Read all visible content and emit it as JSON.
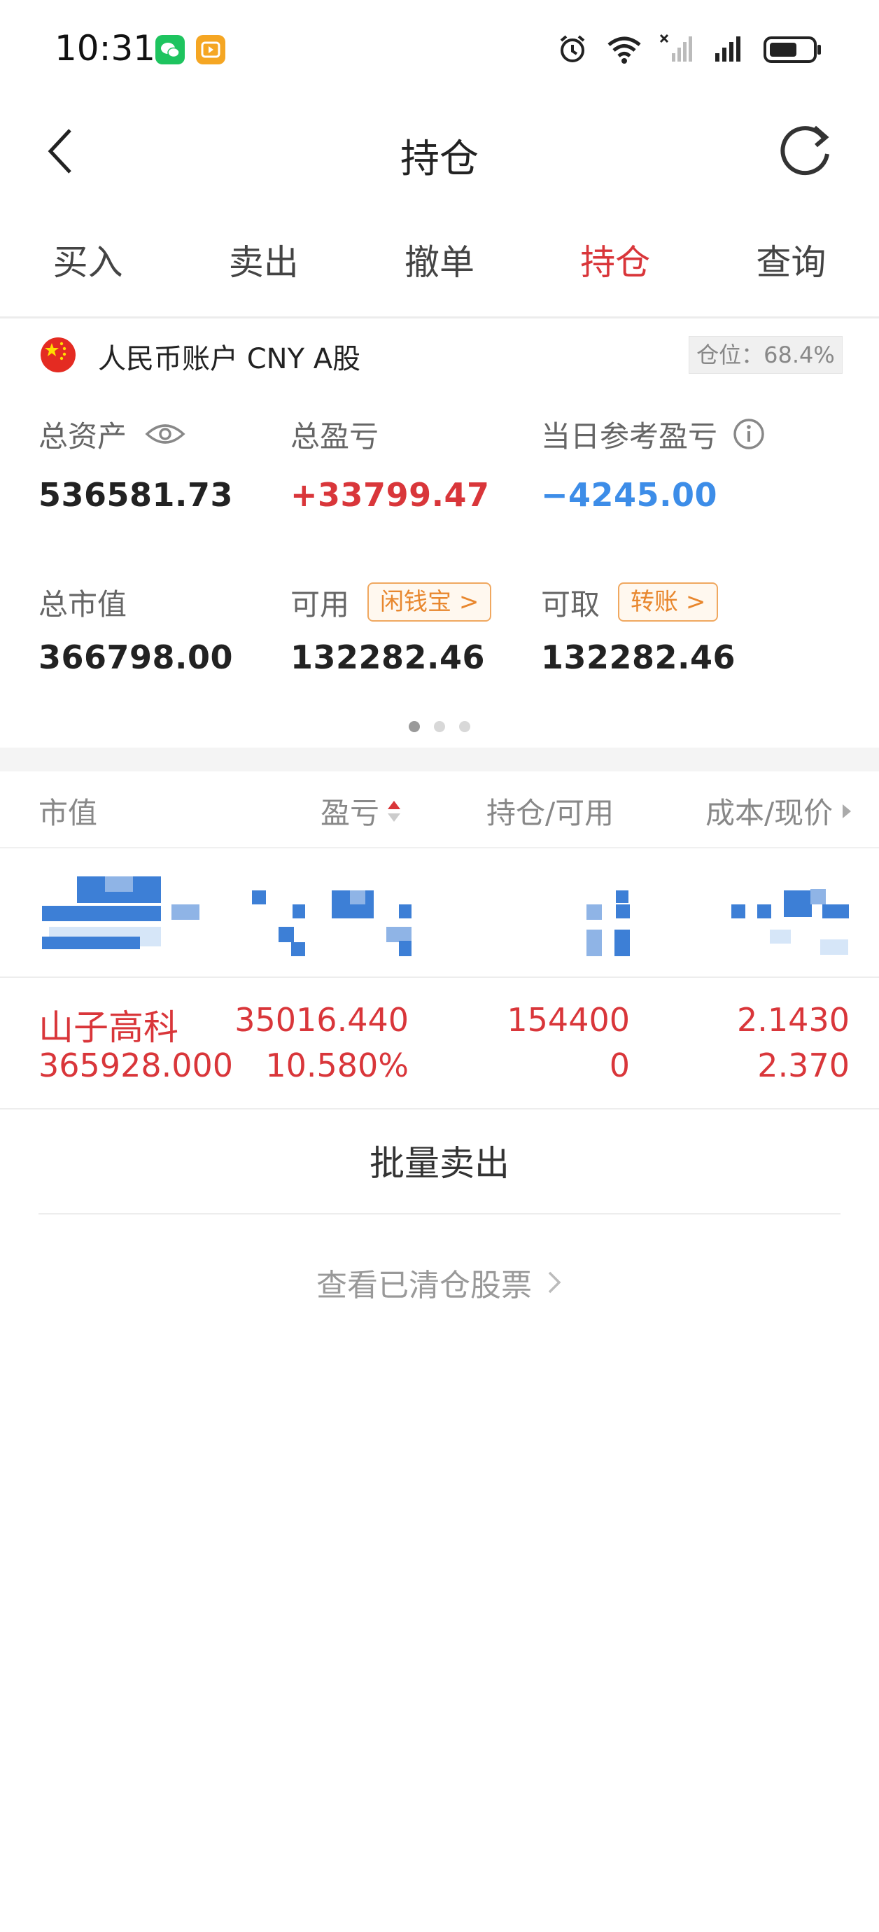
{
  "status_bar": {
    "time": "10:31"
  },
  "header": {
    "title": "持仓"
  },
  "tabs": [
    {
      "label": "买入"
    },
    {
      "label": "卖出"
    },
    {
      "label": "撤单"
    },
    {
      "label": "持仓",
      "active": true
    },
    {
      "label": "查询"
    }
  ],
  "account": {
    "name": "人民币账户 CNY A股",
    "position_ratio": "仓位：68.4%"
  },
  "metrics": {
    "total_assets": {
      "label": "总资产",
      "value": "536581.73"
    },
    "total_pnl": {
      "label": "总盈亏",
      "value": "+33799.47"
    },
    "daily_pnl": {
      "label": "当日参考盈亏",
      "value": "−4245.00"
    },
    "market_value": {
      "label": "总市值",
      "value": "366798.00"
    },
    "available": {
      "label": "可用",
      "value": "132282.46",
      "tag": "闲钱宝 >"
    },
    "withdrawable": {
      "label": "可取",
      "value": "132282.46",
      "tag": "转账 >"
    }
  },
  "list_header": {
    "col1": "市值",
    "col2": "盈亏",
    "col3": "持仓/可用",
    "col4": "成本/现价"
  },
  "holdings": [
    {
      "name": "山子高科",
      "market_value": "365928.000",
      "pnl": "35016.440",
      "pnl_pct": "10.580%",
      "position": "154400",
      "available": "0",
      "cost": "2.1430",
      "price": "2.370"
    }
  ],
  "actions": {
    "batch_sell": "批量卖出",
    "view_cleared": "查看已清仓股票"
  },
  "colors": {
    "accent_red": "#d9363a",
    "loss_blue": "#3d8de8",
    "tag_orange": "#e8872e"
  }
}
